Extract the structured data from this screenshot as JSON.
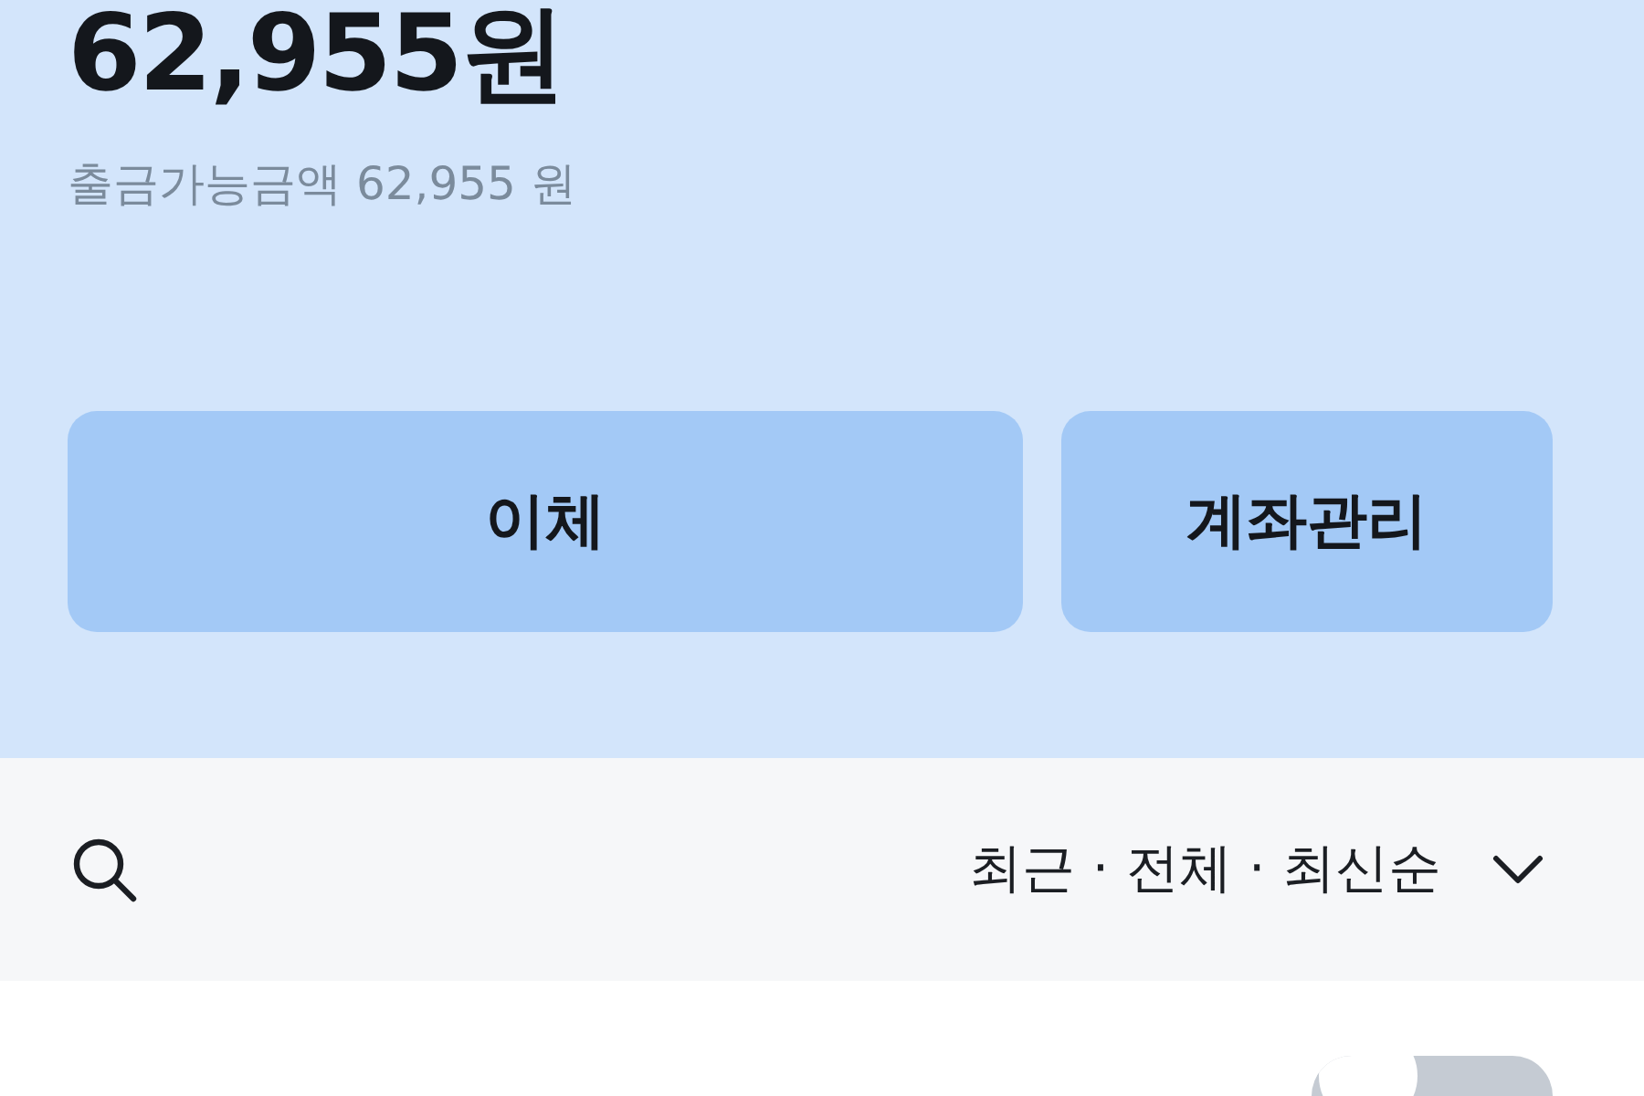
{
  "balance": {
    "amount": "62,955원",
    "withdrawable": "출금가능금액 62,955 원"
  },
  "buttons": [
    {
      "label": "이체"
    },
    {
      "label": "계좌관리"
    }
  ],
  "filter": {
    "label": "최근 · 전체 · 최신순"
  },
  "list_header": {
    "toggle_on": false
  }
}
